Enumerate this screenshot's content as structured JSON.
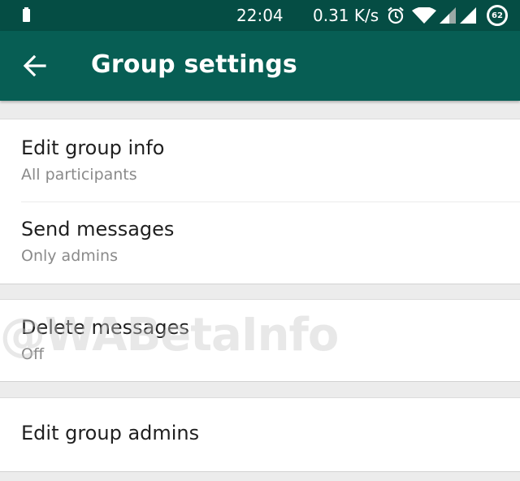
{
  "status_bar": {
    "time": "22:04",
    "network_speed": "0.31 K/s",
    "battery_level": "62",
    "icons": [
      "battery-small-icon",
      "alarm-icon",
      "wifi-icon",
      "signal-icon",
      "signal-icon-2"
    ]
  },
  "app_bar": {
    "title": "Group settings",
    "back_icon": "arrow-left-icon",
    "background_color": "#075e54"
  },
  "settings": {
    "edit_group_info": {
      "label": "Edit group info",
      "value": "All participants"
    },
    "send_messages": {
      "label": "Send messages",
      "value": "Only admins"
    },
    "delete_messages": {
      "label": "Delete messages",
      "value": "Off"
    },
    "edit_group_admins": {
      "label": "Edit group admins"
    }
  },
  "watermark": "@WABetaInfo"
}
